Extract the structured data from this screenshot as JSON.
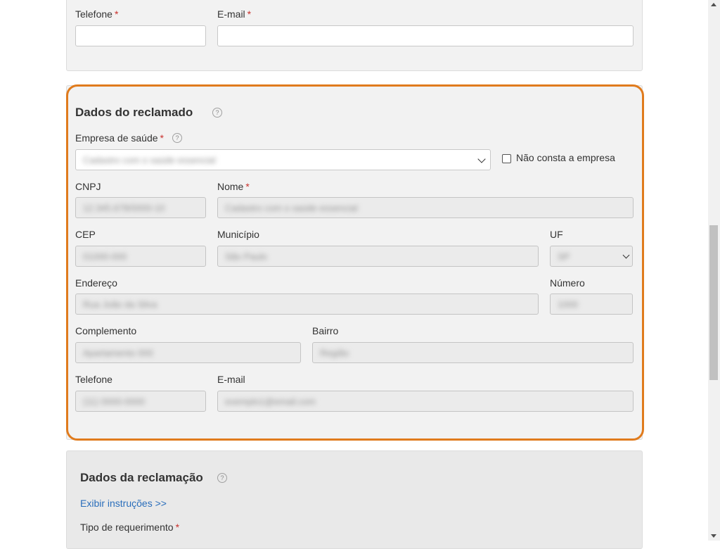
{
  "top_section": {
    "phone_label": "Telefone",
    "email_label": "E-mail",
    "required_mark": "*"
  },
  "respondent": {
    "title": "Dados do reclamado",
    "help_icon": "help-circle-icon",
    "company_label": "Empresa de saúde",
    "company_value": "Cadastro com o saúde essencial",
    "not_listed_label": "Não consta a empresa",
    "cnpj_label": "CNPJ",
    "cnpj_value": "12.345.678/0000-10",
    "name_label": "Nome",
    "name_value": "Cadastro com o saúde essencial",
    "cep_label": "CEP",
    "cep_value": "01000-000",
    "city_label": "Município",
    "city_value": "São Paulo",
    "uf_label": "UF",
    "uf_value": "SP",
    "address_label": "Endereço",
    "address_value": "Rua João da Silva",
    "number_label": "Número",
    "number_value": "1000",
    "complement_label": "Complemento",
    "complement_value": "Apartamento 000",
    "district_label": "Bairro",
    "district_value": "Região",
    "phone_label": "Telefone",
    "phone_value": "(11) 0000-0000",
    "email_label": "E-mail",
    "email_value": "exemplo1@email.com",
    "highlight_color": "#e07b1d"
  },
  "complaint": {
    "title": "Dados da reclamação",
    "instructions_link": "Exibir instruções >>",
    "request_type_label": "Tipo de requerimento"
  }
}
